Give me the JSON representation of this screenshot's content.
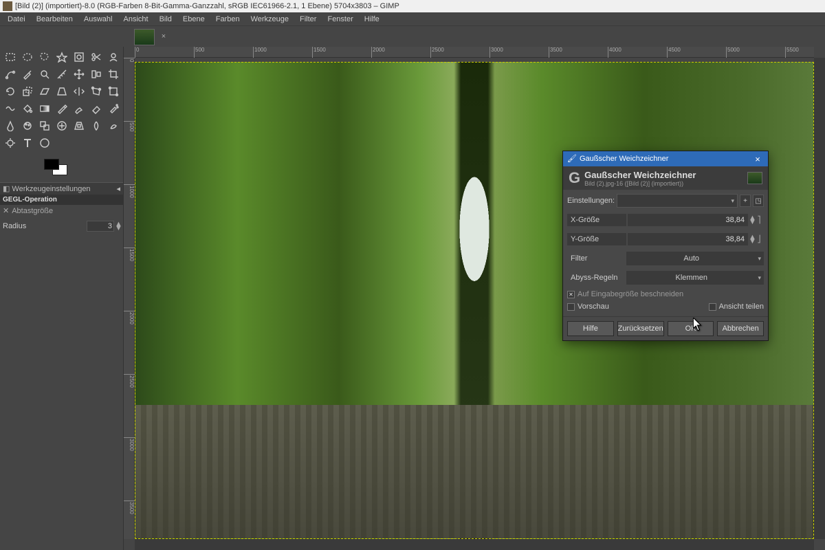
{
  "titlebar": "[Bild (2)] (importiert)-8.0 (RGB-Farben 8-Bit-Gamma-Ganzzahl, sRGB IEC61966-2.1, 1 Ebene) 5704x3803 – GIMP",
  "menu": [
    "Datei",
    "Bearbeiten",
    "Auswahl",
    "Ansicht",
    "Bild",
    "Ebene",
    "Farben",
    "Werkzeuge",
    "Filter",
    "Fenster",
    "Hilfe"
  ],
  "ruler_h": [
    "0",
    "500",
    "1000",
    "1500",
    "2000",
    "2500",
    "3000",
    "3500",
    "4000",
    "4500",
    "5000",
    "5500"
  ],
  "ruler_v": [
    "0",
    "500",
    "1000",
    "1500",
    "2000",
    "2500",
    "3000",
    "3500"
  ],
  "tool_options": {
    "panel": "Werkzeugeinstellungen",
    "gegl": "GEGL-Operation",
    "sub": "Abtastgröße",
    "radius_label": "Radius",
    "radius_value": "3"
  },
  "dialog": {
    "title": "Gaußscher Weichzeichner",
    "head_title": "Gaußscher Weichzeichner",
    "head_sub": "Bild (2).jpg-16 ([Bild (2)] (importiert))",
    "settings_label": "Einstellungen:",
    "x_label": "X-Größe",
    "x_value": "38,84",
    "y_label": "Y-Größe",
    "y_value": "38,84",
    "filter_label": "Filter",
    "filter_value": "Auto",
    "abyss_label": "Abyss-Regeln",
    "abyss_value": "Klemmen",
    "clip_label": "Auf Eingabegröße beschneiden",
    "preview_label": "Vorschau",
    "split_label": "Ansicht teilen",
    "btn_help": "Hilfe",
    "btn_reset": "Zurücksetzen",
    "btn_ok": "OK",
    "btn_cancel": "Abbrechen"
  },
  "tool_names": [
    "rect-select",
    "ellipse-select",
    "free-select",
    "fuzzy-select",
    "by-color-select",
    "scissors",
    "foreground-select",
    "paths",
    "color-picker",
    "zoom",
    "measure",
    "move",
    "align",
    "crop",
    "rotate",
    "scale",
    "shear",
    "perspective",
    "flip",
    "cage",
    "unified",
    "warp",
    "bucket",
    "gradient",
    "pencil",
    "paintbrush",
    "eraser",
    "airbrush",
    "ink",
    "mypaint",
    "clone",
    "heal",
    "perspective-clone",
    "blur",
    "smudge",
    "dodge",
    "text",
    "color"
  ]
}
